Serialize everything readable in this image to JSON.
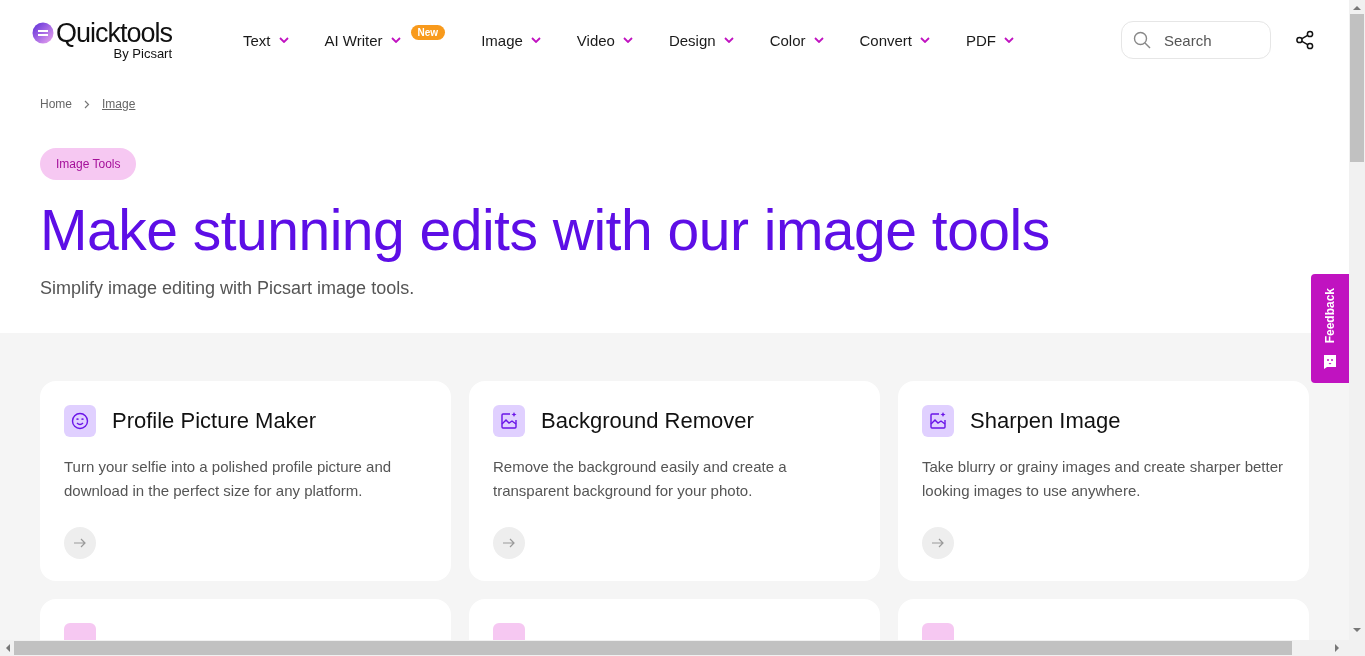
{
  "logo": {
    "name": "Quicktools",
    "byline": "By Picsart"
  },
  "nav": [
    {
      "label": "Text"
    },
    {
      "label": "AI Writer",
      "badge": "New"
    },
    {
      "label": "Image"
    },
    {
      "label": "Video"
    },
    {
      "label": "Design"
    },
    {
      "label": "Color"
    },
    {
      "label": "Convert"
    },
    {
      "label": "PDF"
    }
  ],
  "search": {
    "placeholder": "Search"
  },
  "breadcrumb": [
    {
      "label": "Home",
      "current": false
    },
    {
      "label": "Image",
      "current": true
    }
  ],
  "hero": {
    "tag": "Image Tools",
    "title": "Make stunning edits with our image tools",
    "subtitle": "Simplify image editing with Picsart image tools."
  },
  "cards": [
    {
      "title": "Profile Picture Maker",
      "description": "Turn your selfie into a polished profile picture and download in the perfect size for any platform."
    },
    {
      "title": "Background Remover",
      "description": "Remove the background easily and create a transparent background for your photo."
    },
    {
      "title": "Sharpen Image",
      "description": "Take blurry or grainy images and create sharper better looking images to use anywhere."
    }
  ],
  "feedback": {
    "label": "Feedback"
  }
}
